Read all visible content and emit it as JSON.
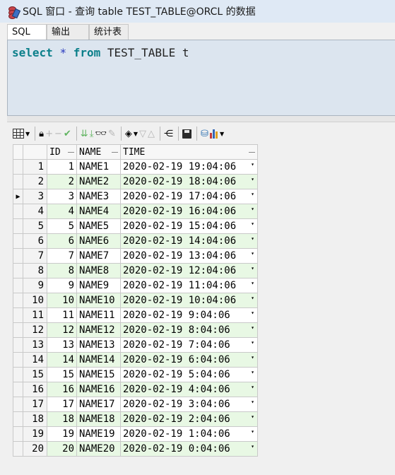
{
  "window": {
    "title": "SQL 窗口 - 查询 table TEST_TABLE@ORCL 的数据"
  },
  "tabs": [
    {
      "label": "SQL"
    },
    {
      "label": "输出"
    },
    {
      "label": "统计表"
    }
  ],
  "editor": {
    "kw_select": "select",
    "star": "*",
    "kw_from": "from",
    "rest": "TEST_TABLE t"
  },
  "toolbar": {
    "icons": [
      "grid-icon",
      "lock-icon",
      "add-icon",
      "remove-icon",
      "post-icon",
      "fetch-next-icon",
      "fetch-last-icon",
      "find-icon",
      "clear-icon",
      "export-icon",
      "sort-desc-icon",
      "sort-asc-icon",
      "query-icon",
      "save-icon",
      "db-icon",
      "chart-icon"
    ],
    "plus": "+",
    "minus": "−",
    "check": "✔",
    "binoculars": "♞"
  },
  "grid": {
    "columns": [
      "ID",
      "NAME",
      "TIME"
    ],
    "current_row_marker": "▶",
    "rows": [
      {
        "rn": "1",
        "id": "1",
        "name": "NAME1",
        "time": "2020-02-19 19:04:06"
      },
      {
        "rn": "2",
        "id": "2",
        "name": "NAME2",
        "time": "2020-02-19 18:04:06"
      },
      {
        "rn": "3",
        "id": "3",
        "name": "NAME3",
        "time": "2020-02-19 17:04:06"
      },
      {
        "rn": "4",
        "id": "4",
        "name": "NAME4",
        "time": "2020-02-19 16:04:06"
      },
      {
        "rn": "5",
        "id": "5",
        "name": "NAME5",
        "time": "2020-02-19 15:04:06"
      },
      {
        "rn": "6",
        "id": "6",
        "name": "NAME6",
        "time": "2020-02-19 14:04:06"
      },
      {
        "rn": "7",
        "id": "7",
        "name": "NAME7",
        "time": "2020-02-19 13:04:06"
      },
      {
        "rn": "8",
        "id": "8",
        "name": "NAME8",
        "time": "2020-02-19 12:04:06"
      },
      {
        "rn": "9",
        "id": "9",
        "name": "NAME9",
        "time": "2020-02-19 11:04:06"
      },
      {
        "rn": "10",
        "id": "10",
        "name": "NAME10",
        "time": "2020-02-19 10:04:06"
      },
      {
        "rn": "11",
        "id": "11",
        "name": "NAME11",
        "time": "2020-02-19 9:04:06"
      },
      {
        "rn": "12",
        "id": "12",
        "name": "NAME12",
        "time": "2020-02-19 8:04:06"
      },
      {
        "rn": "13",
        "id": "13",
        "name": "NAME13",
        "time": "2020-02-19 7:04:06"
      },
      {
        "rn": "14",
        "id": "14",
        "name": "NAME14",
        "time": "2020-02-19 6:04:06"
      },
      {
        "rn": "15",
        "id": "15",
        "name": "NAME15",
        "time": "2020-02-19 5:04:06"
      },
      {
        "rn": "16",
        "id": "16",
        "name": "NAME16",
        "time": "2020-02-19 4:04:06"
      },
      {
        "rn": "17",
        "id": "17",
        "name": "NAME17",
        "time": "2020-02-19 3:04:06"
      },
      {
        "rn": "18",
        "id": "18",
        "name": "NAME18",
        "time": "2020-02-19 2:04:06"
      },
      {
        "rn": "19",
        "id": "19",
        "name": "NAME19",
        "time": "2020-02-19 1:04:06"
      },
      {
        "rn": "20",
        "id": "20",
        "name": "NAME20",
        "time": "2020-02-19 0:04:06"
      }
    ]
  }
}
